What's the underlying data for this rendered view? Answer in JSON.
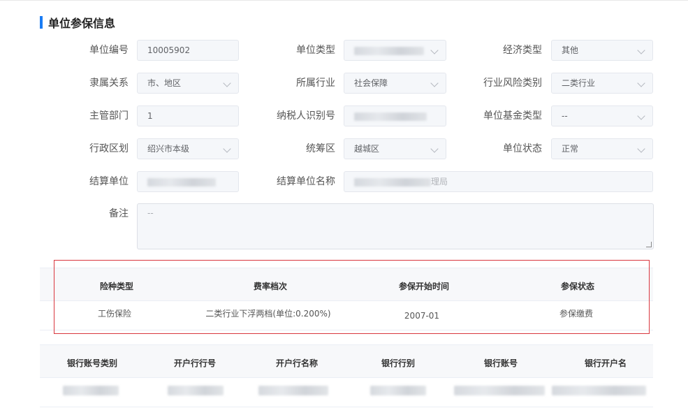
{
  "section": {
    "title": "单位参保信息"
  },
  "form": {
    "unit_code": {
      "label": "单位编号",
      "value": "10005902"
    },
    "unit_type": {
      "label": "单位类型",
      "value": ""
    },
    "economic_type": {
      "label": "经济类型",
      "value": "其他"
    },
    "affiliation": {
      "label": "隶属关系",
      "value": "市、地区"
    },
    "industry": {
      "label": "所属行业",
      "value": "社会保障"
    },
    "industry_risk": {
      "label": "行业风险类别",
      "value": "二类行业"
    },
    "supervisor_dept": {
      "label": "主管部门",
      "value": "1"
    },
    "taxpayer_id": {
      "label": "纳税人识别号",
      "value": ""
    },
    "fund_type": {
      "label": "单位基金类型",
      "value": "--"
    },
    "admin_region": {
      "label": "行政区划",
      "value": "绍兴市本级"
    },
    "pooling_region": {
      "label": "统筹区",
      "value": "越城区"
    },
    "unit_status": {
      "label": "单位状态",
      "value": "正常"
    },
    "settlement_unit": {
      "label": "结算单位",
      "value": ""
    },
    "settlement_unit_name": {
      "label": "结算单位名称",
      "value": "理局"
    },
    "remark": {
      "label": "备注",
      "value": "--"
    }
  },
  "insurance_table": {
    "headers": [
      "险种类型",
      "费率档次",
      "参保开始时间",
      "参保状态"
    ],
    "rows": [
      [
        "工伤保险",
        "二类行业下浮两档(单位:0.200%)",
        "2007-01",
        "参保缴费"
      ]
    ]
  },
  "bank_table": {
    "headers": [
      "银行账号类别",
      "开户行行号",
      "开户行名称",
      "银行行别",
      "银行账号",
      "银行开户名"
    ]
  },
  "colors": {
    "accent": "#1a7cf4",
    "highlight_border": "#d9363e"
  }
}
